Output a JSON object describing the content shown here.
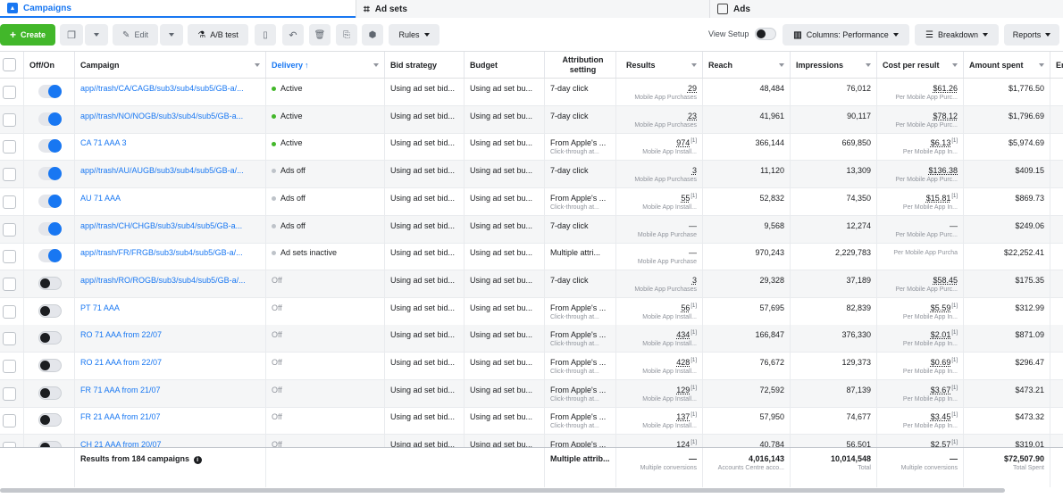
{
  "tabs": {
    "campaigns": "Campaigns",
    "adsets": "Ad sets",
    "ads": "Ads"
  },
  "toolbar": {
    "create": "Create",
    "edit": "Edit",
    "ab_test": "A/B test",
    "rules": "Rules",
    "view_setup": "View Setup",
    "columns": "Columns: Performance",
    "breakdown": "Breakdown",
    "reports": "Reports"
  },
  "colors": {
    "accent": "#1877f2",
    "create": "#42b72a",
    "active_dot": "#42b72a",
    "off_dot": "#bec3c9"
  },
  "headers": {
    "offon": "Off/On",
    "campaign": "Campaign",
    "delivery": "Delivery",
    "bid": "Bid strategy",
    "budget": "Budget",
    "attribution": "Attribution setting",
    "results": "Results",
    "reach": "Reach",
    "impressions": "Impressions",
    "cpr": "Cost per result",
    "spent": "Amount spent",
    "extra": "En"
  },
  "rows": [
    {
      "on": true,
      "campaign": "app//trash/CA/CAGB/sub3/sub4/sub5/GB-a/...",
      "delivery": "Active",
      "status": "active",
      "bid": "Using ad set bid...",
      "budget": "Using ad set bu...",
      "attr": "7-day click",
      "attr_sub": "",
      "result": "29",
      "result_sup": "",
      "result_sub": "Mobile App Purchases",
      "reach": "48,484",
      "impr": "76,012",
      "cpr": "$61.26",
      "cpr_sup": "",
      "cpr_sub": "Per Mobile App Purc...",
      "spent": "$1,776.50"
    },
    {
      "on": true,
      "campaign": "app//trash/NO/NOGB/sub3/sub4/sub5/GB-a...",
      "delivery": "Active",
      "status": "active",
      "bid": "Using ad set bid...",
      "budget": "Using ad set bu...",
      "attr": "7-day click",
      "attr_sub": "",
      "result": "23",
      "result_sup": "",
      "result_sub": "Mobile App Purchases",
      "reach": "41,961",
      "impr": "90,117",
      "cpr": "$78.12",
      "cpr_sup": "",
      "cpr_sub": "Per Mobile App Purc...",
      "spent": "$1,796.69"
    },
    {
      "on": true,
      "campaign": "CA 71 AAA 3",
      "delivery": "Active",
      "status": "active",
      "bid": "Using ad set bid...",
      "budget": "Using ad set bu...",
      "attr": "From Apple's ...",
      "attr_sub": "Click-through at...",
      "result": "974",
      "result_sup": "[1]",
      "result_sub": "Mobile App Install...",
      "reach": "366,144",
      "impr": "669,850",
      "cpr": "$6.13",
      "cpr_sup": "[1]",
      "cpr_sub": "Per Mobile App In...",
      "spent": "$5,974.69"
    },
    {
      "on": true,
      "campaign": "app//trash/AU/AUGB/sub3/sub4/sub5/GB-a/...",
      "delivery": "Ads off",
      "status": "off",
      "bid": "Using ad set bid...",
      "budget": "Using ad set bu...",
      "attr": "7-day click",
      "attr_sub": "",
      "result": "3",
      "result_sup": "",
      "result_sub": "Mobile App Purchases",
      "reach": "11,120",
      "impr": "13,309",
      "cpr": "$136.38",
      "cpr_sup": "",
      "cpr_sub": "Per Mobile App Purc...",
      "spent": "$409.15"
    },
    {
      "on": true,
      "campaign": "AU 71 AAA",
      "delivery": "Ads off",
      "status": "off",
      "bid": "Using ad set bid...",
      "budget": "Using ad set bu...",
      "attr": "From Apple's ...",
      "attr_sub": "Click-through at...",
      "result": "55",
      "result_sup": "[1]",
      "result_sub": "Mobile App Install...",
      "reach": "52,832",
      "impr": "74,350",
      "cpr": "$15.81",
      "cpr_sup": "[1]",
      "cpr_sub": "Per Mobile App In...",
      "spent": "$869.73"
    },
    {
      "on": true,
      "campaign": "app//trash/CH/CHGB/sub3/sub4/sub5/GB-a...",
      "delivery": "Ads off",
      "status": "off",
      "bid": "Using ad set bid...",
      "budget": "Using ad set bu...",
      "attr": "7-day click",
      "attr_sub": "",
      "result": "—",
      "result_sup": "",
      "result_sub": "Mobile App Purchase",
      "reach": "9,568",
      "impr": "12,274",
      "cpr": "—",
      "cpr_sup": "",
      "cpr_sub": "Per Mobile App Purc...",
      "spent": "$249.06"
    },
    {
      "on": true,
      "campaign": "app//trash/FR/FRGB/sub3/sub4/sub5/GB-a/...",
      "delivery": "Ad sets inactive",
      "status": "off",
      "bid": "Using ad set bid...",
      "budget": "Using ad set bu...",
      "attr": "Multiple attri...",
      "attr_sub": "",
      "result": "—",
      "result_sup": "",
      "result_sub": "Mobile App Purchase",
      "reach": "970,243",
      "impr": "2,229,783",
      "cpr": "",
      "cpr_sup": "",
      "cpr_sub": "Per Mobile App Purcha",
      "spent": "$22,252.41"
    },
    {
      "on": false,
      "campaign": "app//trash/RO/ROGB/sub3/sub4/sub5/GB-a/...",
      "delivery": "Off",
      "status": "none",
      "bid": "Using ad set bid...",
      "budget": "Using ad set bu...",
      "attr": "7-day click",
      "attr_sub": "",
      "result": "3",
      "result_sup": "",
      "result_sub": "Mobile App Purchases",
      "reach": "29,328",
      "impr": "37,189",
      "cpr": "$58.45",
      "cpr_sup": "",
      "cpr_sub": "Per Mobile App Purc...",
      "spent": "$175.35"
    },
    {
      "on": false,
      "campaign": "PT 71 AAA",
      "delivery": "Off",
      "status": "none",
      "bid": "Using ad set bid...",
      "budget": "Using ad set bu...",
      "attr": "From Apple's ...",
      "attr_sub": "Click-through at...",
      "result": "56",
      "result_sup": "[1]",
      "result_sub": "Mobile App Install...",
      "reach": "57,695",
      "impr": "82,839",
      "cpr": "$5.59",
      "cpr_sup": "[1]",
      "cpr_sub": "Per Mobile App In...",
      "spent": "$312.99"
    },
    {
      "on": false,
      "campaign": "RO 71 AAA from 22/07",
      "delivery": "Off",
      "status": "none",
      "bid": "Using ad set bid...",
      "budget": "Using ad set bu...",
      "attr": "From Apple's ...",
      "attr_sub": "Click-through at...",
      "result": "434",
      "result_sup": "[1]",
      "result_sub": "Mobile App Install...",
      "reach": "166,847",
      "impr": "376,330",
      "cpr": "$2.01",
      "cpr_sup": "[1]",
      "cpr_sub": "Per Mobile App In...",
      "spent": "$871.09"
    },
    {
      "on": false,
      "campaign": "RO 21 AAA from 22/07",
      "delivery": "Off",
      "status": "none",
      "bid": "Using ad set bid...",
      "budget": "Using ad set bu...",
      "attr": "From Apple's ...",
      "attr_sub": "Click-through at...",
      "result": "428",
      "result_sup": "[1]",
      "result_sub": "Mobile App Install...",
      "reach": "76,672",
      "impr": "129,373",
      "cpr": "$0.69",
      "cpr_sup": "[1]",
      "cpr_sub": "Per Mobile App In...",
      "spent": "$296.47"
    },
    {
      "on": false,
      "campaign": "FR 71 AAA from 21/07",
      "delivery": "Off",
      "status": "none",
      "bid": "Using ad set bid...",
      "budget": "Using ad set bu...",
      "attr": "From Apple's ...",
      "attr_sub": "Click-through at...",
      "result": "129",
      "result_sup": "[1]",
      "result_sub": "Mobile App Install...",
      "reach": "72,592",
      "impr": "87,139",
      "cpr": "$3.67",
      "cpr_sup": "[1]",
      "cpr_sub": "Per Mobile App In...",
      "spent": "$473.21"
    },
    {
      "on": false,
      "campaign": "FR 21 AAA from 21/07",
      "delivery": "Off",
      "status": "none",
      "bid": "Using ad set bid...",
      "budget": "Using ad set bu...",
      "attr": "From Apple's ...",
      "attr_sub": "Click-through at...",
      "result": "137",
      "result_sup": "[1]",
      "result_sub": "Mobile App Install...",
      "reach": "57,950",
      "impr": "74,677",
      "cpr": "$3.45",
      "cpr_sup": "[1]",
      "cpr_sub": "Per Mobile App In...",
      "spent": "$473.32"
    },
    {
      "on": false,
      "campaign": "CH 21 AAA from 20/07",
      "delivery": "Off",
      "status": "none",
      "bid": "Using ad set bid...",
      "budget": "Using ad set bu...",
      "attr": "From Apple's ...",
      "attr_sub": "",
      "result": "124",
      "result_sup": "[1]",
      "result_sub": "",
      "reach": "40,784",
      "impr": "56,501",
      "cpr": "$2.57",
      "cpr_sup": "[1]",
      "cpr_sub": "",
      "spent": "$319.01"
    }
  ],
  "footer": {
    "label": "Results from 184 campaigns",
    "attr": "Multiple attrib...",
    "result": "—",
    "result_sub": "Multiple conversions",
    "reach": "4,016,143",
    "reach_sub": "Accounts Centre acco...",
    "impr": "10,014,548",
    "impr_sub": "Total",
    "cpr": "—",
    "cpr_sub": "Multiple conversions",
    "spent": "$72,507.90",
    "spent_sub": "Total Spent"
  }
}
